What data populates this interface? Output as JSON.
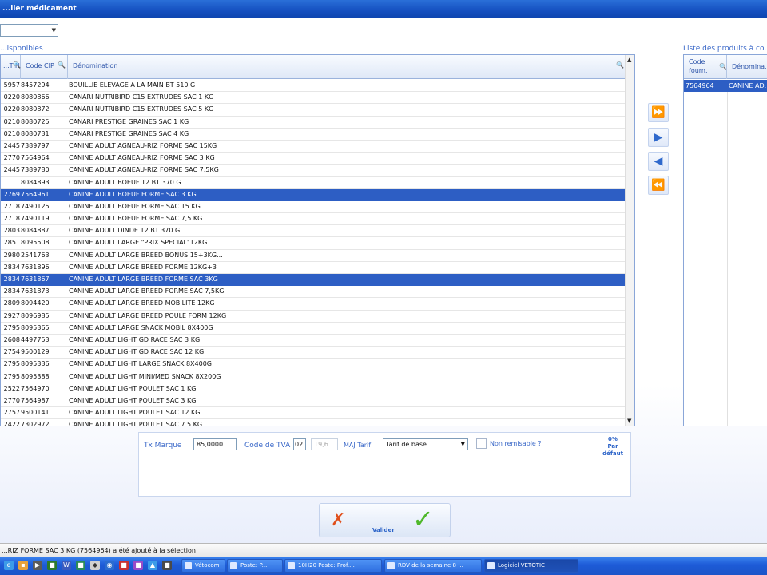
{
  "window": {
    "title": "...iler médicament"
  },
  "filter": {
    "value": ""
  },
  "available": {
    "label": "...isponibles",
    "columns": [
      "...TIN",
      "Code CIP",
      "Dénomination"
    ],
    "rows": [
      {
        "a": "5957",
        "cip": "8457294",
        "name": "BOUILLIE ELEVAGE A LA MAIN      BT 510 G",
        "sel": false
      },
      {
        "a": "0220",
        "cip": "8080866",
        "name": "CANARI NUTRIBIRD C15 EXTRUDES    SAC 1 KG",
        "sel": false
      },
      {
        "a": "0220",
        "cip": "8080872",
        "name": "CANARI NUTRIBIRD C15 EXTRUDES    SAC 5 KG",
        "sel": false
      },
      {
        "a": "0210",
        "cip": "8080725",
        "name": "CANARI PRESTIGE GRAINES          SAC 1 KG",
        "sel": false
      },
      {
        "a": "0210",
        "cip": "8080731",
        "name": "CANARI PRESTIGE GRAINES          SAC 4 KG",
        "sel": false
      },
      {
        "a": "2445",
        "cip": "7389797",
        "name": "CANINE ADULT AGNEAU-RIZ FORME    SAC 15KG",
        "sel": false
      },
      {
        "a": "2770",
        "cip": "7564964",
        "name": "CANINE ADULT AGNEAU-RIZ FORME    SAC 3 KG",
        "sel": false
      },
      {
        "a": "2445",
        "cip": "7389780",
        "name": "CANINE ADULT AGNEAU-RIZ FORME  SAC 7,5KG",
        "sel": false
      },
      {
        "a": "",
        "cip": "8084893",
        "name": "CANINE ADULT BOEUF            12 BT 370 G",
        "sel": false
      },
      {
        "a": "2769",
        "cip": "7564961",
        "name": "CANINE ADULT BOEUF FORME         SAC 3 KG",
        "sel": true
      },
      {
        "a": "2718",
        "cip": "7490125",
        "name": "CANINE ADULT BOEUF FORME         SAC 15 KG",
        "sel": false
      },
      {
        "a": "2718",
        "cip": "7490119",
        "name": "CANINE ADULT BOEUF FORME         SAC 7,5 KG",
        "sel": false
      },
      {
        "a": "2803",
        "cip": "8084887",
        "name": "CANINE ADULT DINDE            12 BT 370 G",
        "sel": false
      },
      {
        "a": "2851",
        "cip": "8095508",
        "name": "CANINE ADULT LARGE \"PRIX SPECIAL\"12KG...",
        "sel": false
      },
      {
        "a": "2980",
        "cip": "2541763",
        "name": "CANINE ADULT LARGE BREED BONUS 15+3KG...",
        "sel": false
      },
      {
        "a": "2834",
        "cip": "7631896",
        "name": "CANINE ADULT LARGE BREED FORME     12KG+3",
        "sel": false
      },
      {
        "a": "2834",
        "cip": "7631867",
        "name": "CANINE ADULT LARGE BREED FORME    SAC 3KG",
        "sel": true
      },
      {
        "a": "2834",
        "cip": "7631873",
        "name": "CANINE ADULT LARGE BREED FORME SAC 7,5KG",
        "sel": false
      },
      {
        "a": "2809",
        "cip": "8094420",
        "name": "CANINE ADULT LARGE BREED MOBILITE   12KG",
        "sel": false
      },
      {
        "a": "2927",
        "cip": "8096985",
        "name": "CANINE ADULT LARGE BREED POULE FORM 12KG",
        "sel": false
      },
      {
        "a": "2795",
        "cip": "8095365",
        "name": "CANINE ADULT LARGE SNACK MOBIL     8X400G",
        "sel": false
      },
      {
        "a": "2608",
        "cip": "4497753",
        "name": "CANINE ADULT LIGHT GD RACE        SAC 3 KG",
        "sel": false
      },
      {
        "a": "2754",
        "cip": "9500129",
        "name": "CANINE ADULT LIGHT GD RACE        SAC 12 KG",
        "sel": false
      },
      {
        "a": "2795",
        "cip": "8095336",
        "name": "CANINE ADULT LIGHT LARGE SNACK     8X400G",
        "sel": false
      },
      {
        "a": "2795",
        "cip": "8095388",
        "name": "CANINE ADULT LIGHT MINI/MED SNACK 8X200G",
        "sel": false
      },
      {
        "a": "2522",
        "cip": "7564970",
        "name": "CANINE ADULT LIGHT POULET         SAC 1 KG",
        "sel": false
      },
      {
        "a": "2770",
        "cip": "7564987",
        "name": "CANINE ADULT LIGHT POULET         SAC 3 KG",
        "sel": false
      },
      {
        "a": "2757",
        "cip": "9500141",
        "name": "CANINE ADULT LIGHT POULET         SAC 12 KG",
        "sel": false
      },
      {
        "a": "2422",
        "cip": "7302972",
        "name": "CANINE ADULT LIGHT POULET         SAC 7,5 KG",
        "sel": false
      }
    ]
  },
  "ordered": {
    "label": "Liste des produits à co...",
    "col1_line1": "Code",
    "col1_line2": "fourn.",
    "col2": "Dénomina...",
    "row": {
      "code": "7564964",
      "name": "CANINE AD..."
    }
  },
  "form": {
    "margin_label": "Tx Marque",
    "margin_value": "85,0000",
    "tva_label": "Code de TVA",
    "tva_value": "02",
    "tva_rate": "19,6",
    "tariff_label": "MAJ Tarif",
    "tariff_value": "Tarif de base",
    "non_remisable_label": "Non remisable ?",
    "default_line1": "0%",
    "default_line2": "Par",
    "default_line3": "défaut"
  },
  "actions": {
    "validate_label": "Valider"
  },
  "status": {
    "text": "...RIZ FORME   SAC 3 KG (7564964) a été ajouté à la sélection"
  },
  "taskbar": {
    "items": [
      {
        "label": "Vétocom"
      },
      {
        "label": "Poste: P..."
      },
      {
        "label": "10H20 Poste: Prof...."
      },
      {
        "label": "RDV de la semaine 8 ..."
      },
      {
        "label": "Logiciel  VETOTIC"
      }
    ]
  },
  "colors": {
    "accent": "#2d5ec4",
    "title_bar": "#1550c0",
    "taskbar": "#1d5bd7"
  }
}
